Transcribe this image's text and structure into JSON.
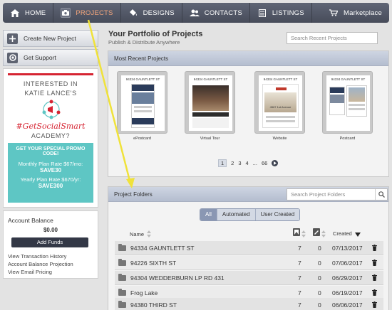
{
  "nav": {
    "items": [
      {
        "label": "HOME",
        "icon": "home-icon"
      },
      {
        "label": "PROJECTS",
        "icon": "camera-icon",
        "active": true
      },
      {
        "label": "DESIGNS",
        "icon": "paint-bucket-icon"
      },
      {
        "label": "CONTACTS",
        "icon": "contacts-icon"
      },
      {
        "label": "LISTINGS",
        "icon": "listings-icon"
      }
    ],
    "marketplace": "Marketplace",
    "active_color": "#f2a47a"
  },
  "sidebar": {
    "create_label": "Create New Project",
    "support_label": "Get Support"
  },
  "ad": {
    "line1": "INTERESTED IN",
    "line2": "KATIE LANCE'S",
    "hashtag": "#GetSocialSmart",
    "academy": "ACADEMY?",
    "promo_title": "GET YOUR SPECIAL PROMO CODE!",
    "monthly": "Monthly Plan Rate $67/mo:",
    "monthly_code": "SAVE30",
    "yearly": "Yearly Plan Rate $670/yr:",
    "yearly_code": "SAVE300",
    "brand_red": "#d62432",
    "teal": "#5ec6c4"
  },
  "account": {
    "title": "Account Balance",
    "amount": "$0.00",
    "add_funds": "Add Funds",
    "link1": "View Transaction History",
    "link2": "Account Balance Projection",
    "link3": "View Email Pricing"
  },
  "header": {
    "title": "Your Portfolio of Projects",
    "subtitle": "Publish & Distribute Anywhere",
    "search_placeholder": "Search Recent Projects"
  },
  "recent": {
    "heading": "Most Recent Projects",
    "cards": [
      {
        "addr": "94334 GAUNTLETT ST",
        "label": "ePostcard"
      },
      {
        "addr": "94334 GAUNTLETT ST",
        "label": "Virtual Tour"
      },
      {
        "addr": "94334 GAUNTLETT ST",
        "label": "Website",
        "inner": "4567 1st Avenue"
      },
      {
        "addr": "94334 GAUNTLETT ST",
        "label": "Postcard"
      }
    ],
    "pager": {
      "p1": "1",
      "p2": "2",
      "p3": "3",
      "p4": "4",
      "ellipsis": "...",
      "last": "66"
    }
  },
  "folders": {
    "heading": "Project Folders",
    "search_placeholder": "Search Project Folders",
    "filters": [
      "All",
      "Automated",
      "User Created"
    ],
    "col_name": "Name",
    "col_created": "Created",
    "rows": [
      {
        "name": "94334 GAUNTLETT ST",
        "c1": "7",
        "c2": "0",
        "date": "07/13/2017"
      },
      {
        "name": "94226 SIXTH ST",
        "c1": "7",
        "c2": "0",
        "date": "07/06/2017"
      },
      {
        "name": "94304 WEDDERBURN LP RD 431",
        "c1": "7",
        "c2": "0",
        "date": "06/29/2017"
      },
      {
        "name": "Frog Lake",
        "c1": "7",
        "c2": "0",
        "date": "06/19/2017"
      },
      {
        "name": "94380 THIRD ST",
        "c1": "7",
        "c2": "0",
        "date": "06/06/2017"
      }
    ]
  },
  "annotation_color": "#f0e23a"
}
